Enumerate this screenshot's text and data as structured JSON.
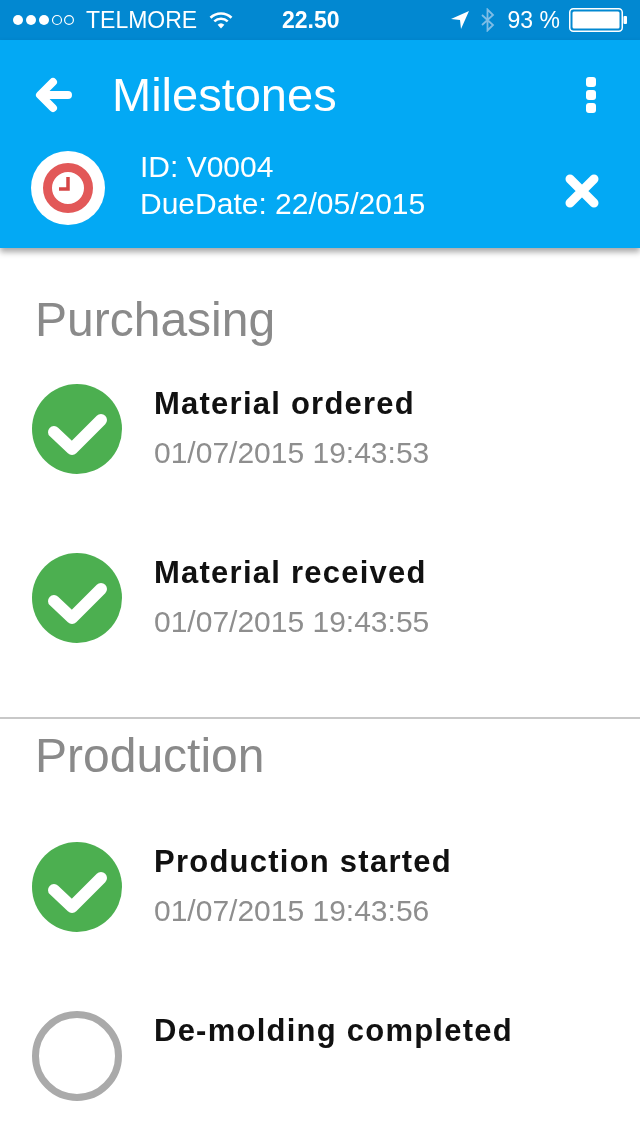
{
  "status_bar": {
    "carrier": "TELMORE",
    "time": "22.50",
    "bluetooth_connected": false,
    "battery": "93 %"
  },
  "app_bar": {
    "title": "Milestones"
  },
  "order": {
    "id": "ID: V0004",
    "due_date": "DueDate: 22/05/2015"
  },
  "sections": [
    {
      "title": "Purchasing",
      "milestones": [
        {
          "name": "Material ordered",
          "timestamp": "01/07/2015 19:43:53",
          "checked": true
        },
        {
          "name": "Material received",
          "timestamp": "01/07/2015 19:43:55",
          "checked": true
        }
      ]
    },
    {
      "title": "Production",
      "milestones": [
        {
          "name": "Production started",
          "timestamp": "01/07/2015 19:43:56",
          "checked": true
        },
        {
          "name": "De-molding completed",
          "checked": false
        }
      ]
    }
  ]
}
